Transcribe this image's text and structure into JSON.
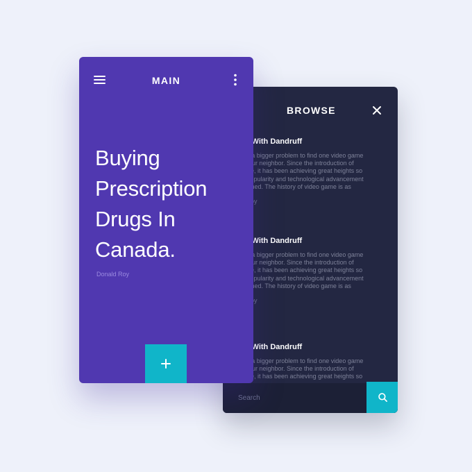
{
  "browse": {
    "title": "BROWSE",
    "articles": [
      {
        "title": "ing With Dandruff",
        "lines": [
          "'t be a bigger problem to find one video game",
          "in your neighbor. Since the introduction of",
          "l Game, it has been achieving great heights so",
          "its popularity and technological advancement",
          "oncerned. The history of video game is as"
        ],
        "author": "d Roy"
      },
      {
        "title": "ing With Dandruff",
        "lines": [
          "'t be a bigger problem to find one video game",
          "in your neighbor. Since the introduction of",
          "l Game, it has been achieving great heights so",
          "its popularity and technological advancement",
          "oncerned. The history of video game is as"
        ],
        "author": "d Roy"
      },
      {
        "title": "ing With Dandruff",
        "lines": [
          "'t be a bigger problem to find one video game",
          "in your neighbor. Since the introduction of",
          "l Game, it has been achieving great heights so"
        ],
        "author": ""
      }
    ],
    "search": {
      "placeholder": "Search",
      "value": ""
    }
  },
  "main": {
    "title": "MAIN",
    "headline_lines": [
      "Buying",
      "Prescription",
      "Drugs In",
      "Canada."
    ],
    "author": "Donald Roy"
  },
  "colors": {
    "background": "#eef1fa",
    "main_card": "#5038b0",
    "browse_card": "#232742",
    "accent": "#10b5c9"
  },
  "icons": {
    "menu": "hamburger-menu-icon",
    "more": "more-vertical-icon",
    "close": "close-icon",
    "add": "plus-icon",
    "search": "search-icon"
  }
}
